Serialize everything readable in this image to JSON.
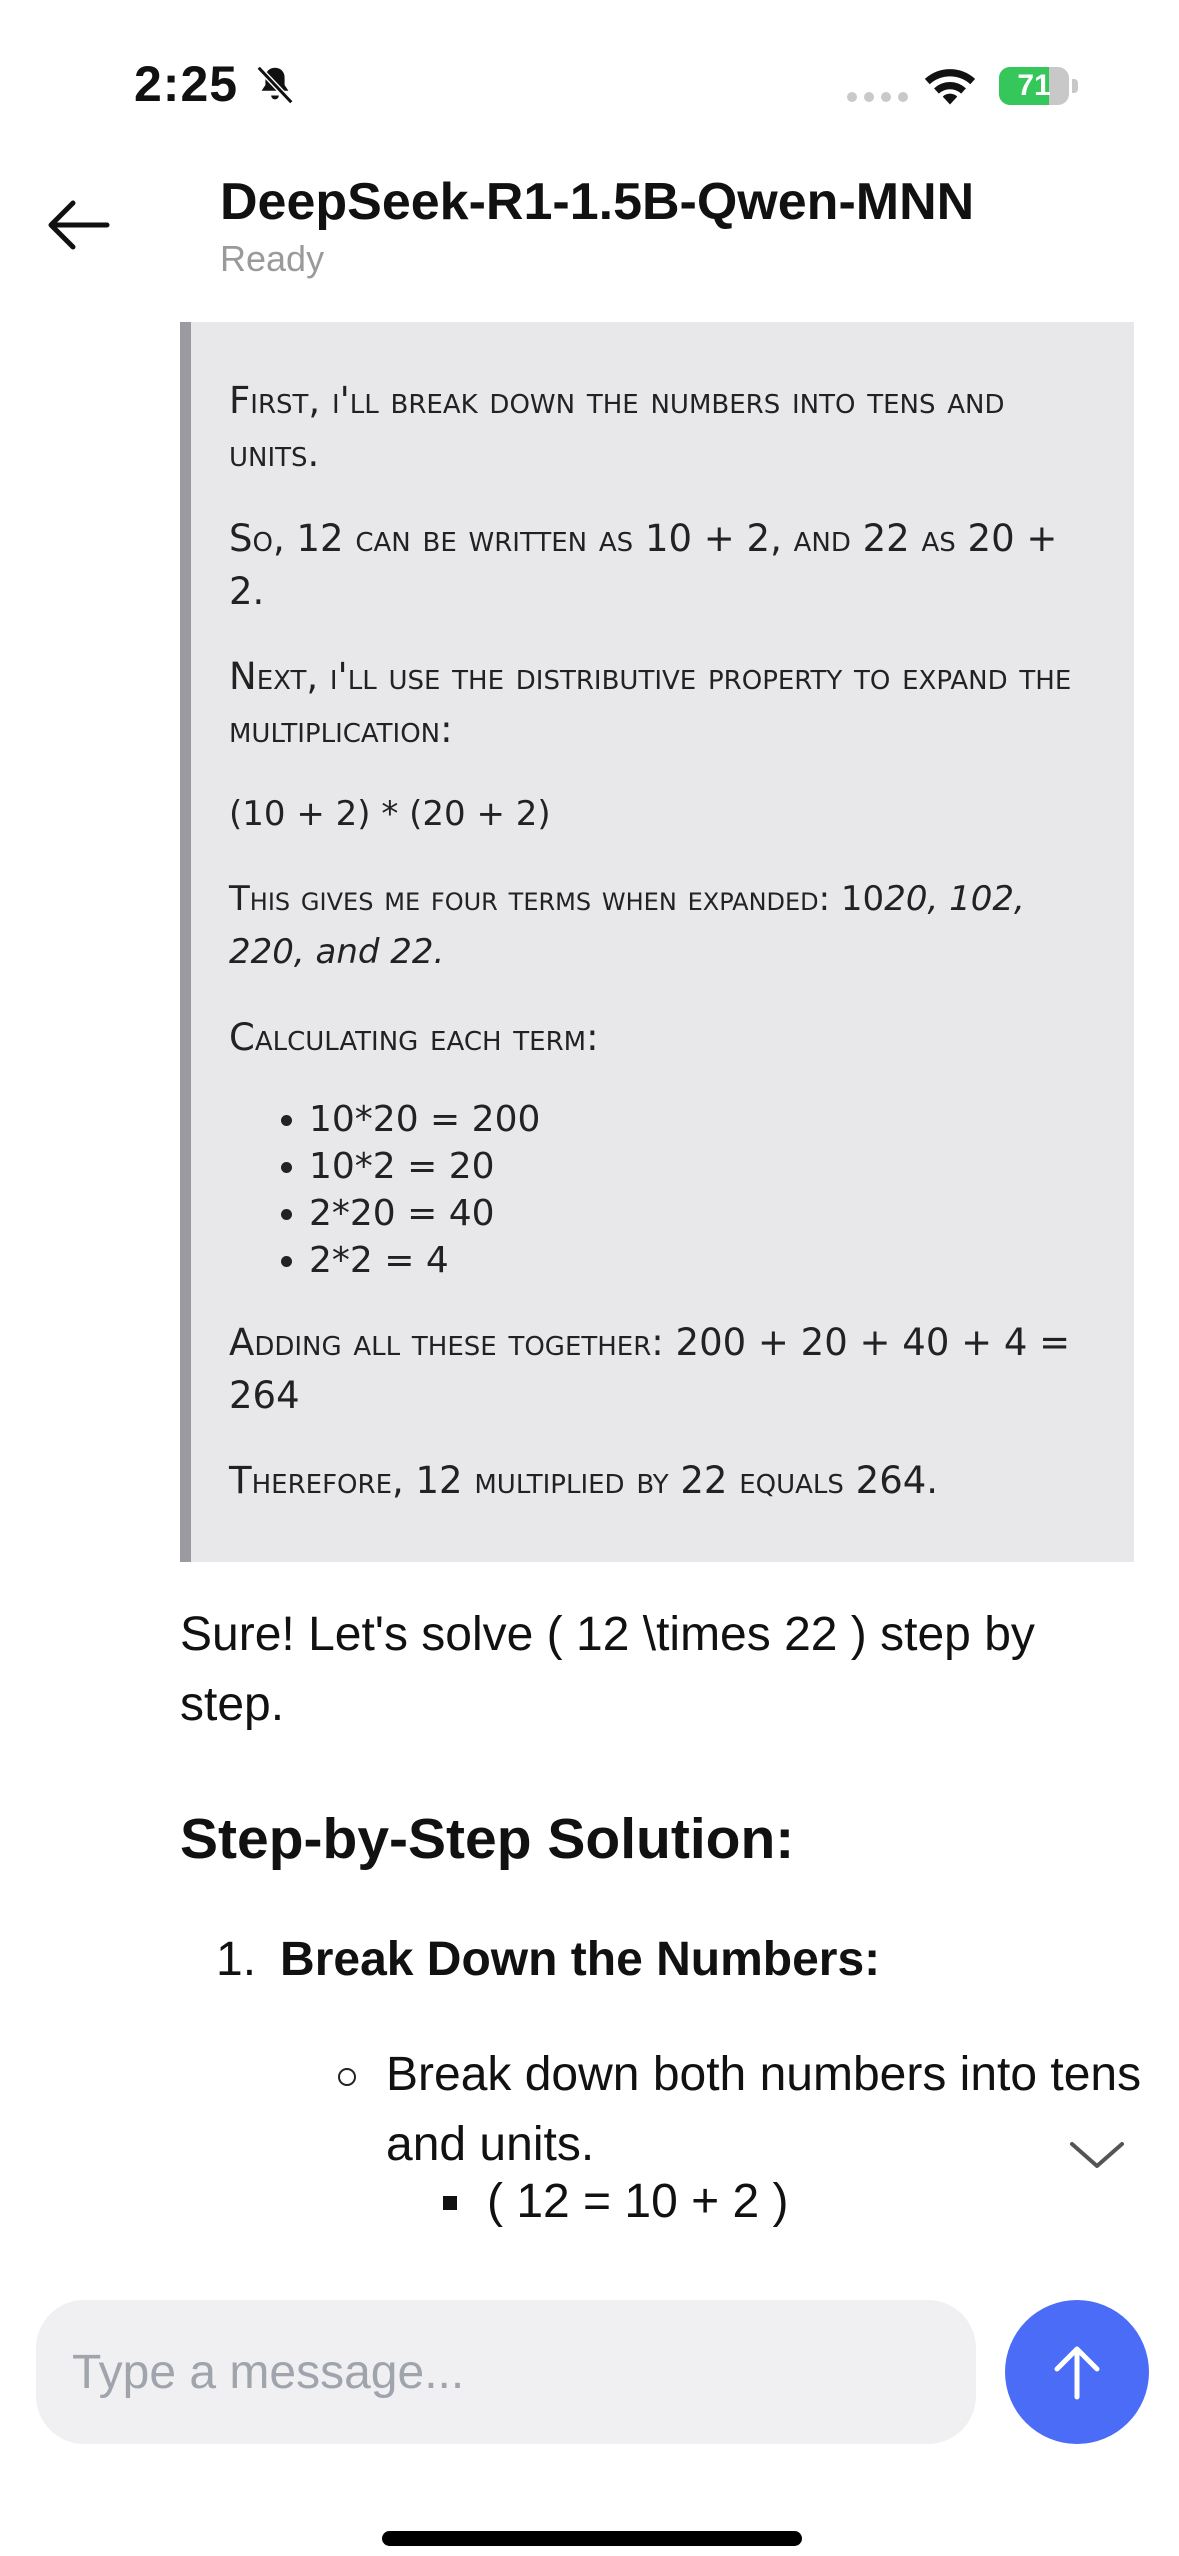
{
  "status_bar": {
    "time": "2:25",
    "battery_level": "71",
    "battery_fraction": 0.71,
    "colors": {
      "battery": "#35c759"
    }
  },
  "header": {
    "title": "DeepSeek-R1-1.5B-Qwen-MNN",
    "status": "Ready"
  },
  "thinking": {
    "p1": "First, I'll break down the numbers into tens and units.",
    "p2": "So, 12 can be written as 10 + 2, and 22 as 20 + 2.",
    "p3": "Next, I'll use the distributive property to expand the multiplication:",
    "p4": "(10 + 2) * (20 + 2)",
    "p5": "This gives me four terms when expanded: 10",
    "p5_italic": "20, 102, 220, and 22.",
    "p6": "Calculating each term:",
    "terms": [
      "10*20 = 200",
      "10*2 = 20",
      "2*20 = 40",
      "2*2 = 4"
    ],
    "p7": "Adding all these together: 200 + 20 + 40 + 4 = 264",
    "p8": "Therefore, 12 multiplied by 22 equals 264."
  },
  "answer": {
    "intro": "Sure! Let's solve ( 12 \\times 22 ) step by step.",
    "heading": "Step-by-Step Solution:",
    "step1_number": "1.",
    "step1_title": "Break Down the Numbers:",
    "step1_bullet": "Break down both numbers into tens and units.",
    "step1_sub": "( 12 = 10 + 2 )"
  },
  "composer": {
    "placeholder": "Type a message...",
    "colors": {
      "send_button": "#4a6cf7"
    }
  },
  "icons": {
    "back": "arrow-left-icon",
    "bell": "bell-slash-icon",
    "wifi": "wifi-icon",
    "scroll_down": "chevron-down-icon",
    "send": "arrow-up-icon"
  }
}
